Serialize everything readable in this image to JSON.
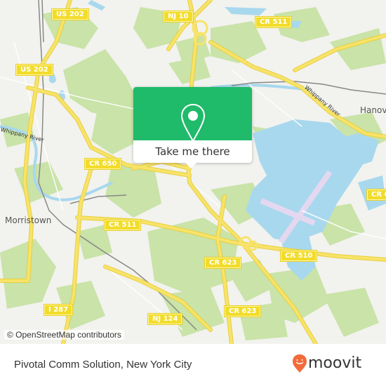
{
  "map": {
    "attribution": "© OpenStreetMap contributors",
    "colors": {
      "background": "#f2f2ee",
      "park": "#c9e3a8",
      "water": "#a8d8ee",
      "road": "#f7e36a",
      "road_casing": "#e8cf3a",
      "rail": "#888888",
      "runway": "#e4d8f0"
    },
    "route_shields": [
      {
        "label": "US 202"
      },
      {
        "label": "NJ 10"
      },
      {
        "label": "CR 511"
      },
      {
        "label": "US 202"
      },
      {
        "label": "CR 650"
      },
      {
        "label": "CR 511"
      },
      {
        "label": "CR 623"
      },
      {
        "label": "CR 510"
      },
      {
        "label": "CR 6"
      },
      {
        "label": "CR 623"
      },
      {
        "label": "I 287"
      },
      {
        "label": "NJ 124"
      }
    ],
    "places": [
      {
        "label": "Morristown"
      },
      {
        "label": "Hanov"
      }
    ],
    "water_labels": [
      {
        "label": "Whippany River"
      },
      {
        "label": "Whippany River"
      }
    ]
  },
  "popup": {
    "icon": "location-pin-icon",
    "button_label": "Take me there",
    "color": "#1fba6a"
  },
  "footer": {
    "location_title": "Pivotal Comm Solution, New York City",
    "brand": "moovit",
    "brand_color": "#f26b3a"
  }
}
